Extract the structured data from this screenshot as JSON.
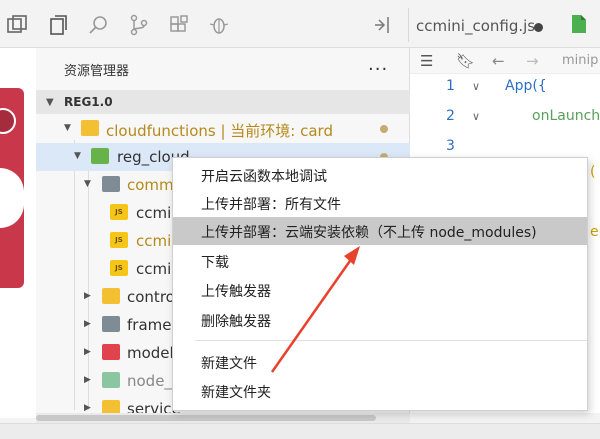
{
  "window": {
    "editor_tab": "ccmini_config.js",
    "accent_red": "#e0434c"
  },
  "explorer": {
    "title": "资源管理器",
    "more": "...",
    "root": "REG1.0",
    "items": [
      {
        "label": "cloudfunctions | 当前环境: card",
        "icon": "folder-yellow"
      },
      {
        "label": "reg_cloud",
        "icon": "folder-green"
      },
      {
        "label": "comm",
        "icon": "folder-grey"
      },
      {
        "label": "ccmi",
        "icon": "js-file"
      },
      {
        "label": "ccmi",
        "icon": "js-file"
      },
      {
        "label": "ccmi",
        "icon": "js-file"
      },
      {
        "label": "contro",
        "icon": "folder-yellow"
      },
      {
        "label": "framev",
        "icon": "folder-grey"
      },
      {
        "label": "model",
        "icon": "folder-red"
      },
      {
        "label": "node_",
        "icon": "folder-lightgreen"
      },
      {
        "label": "service",
        "icon": "folder-yellow"
      }
    ],
    "js_badge": "JS"
  },
  "editor": {
    "crumb": "minip",
    "line_numbers": [
      "1",
      "2",
      "3"
    ],
    "code_line1": "App({",
    "code_line2": "onLaunch",
    "frag_a": "(",
    "frag_b": "el"
  },
  "context_menu": {
    "items": [
      "开启云函数本地调试",
      "上传并部署：所有文件",
      "上传并部署：云端安装依赖（不上传 node_modules)",
      "下载",
      "上传触发器",
      "删除触发器",
      "新建文件",
      "新建文件夹"
    ]
  }
}
